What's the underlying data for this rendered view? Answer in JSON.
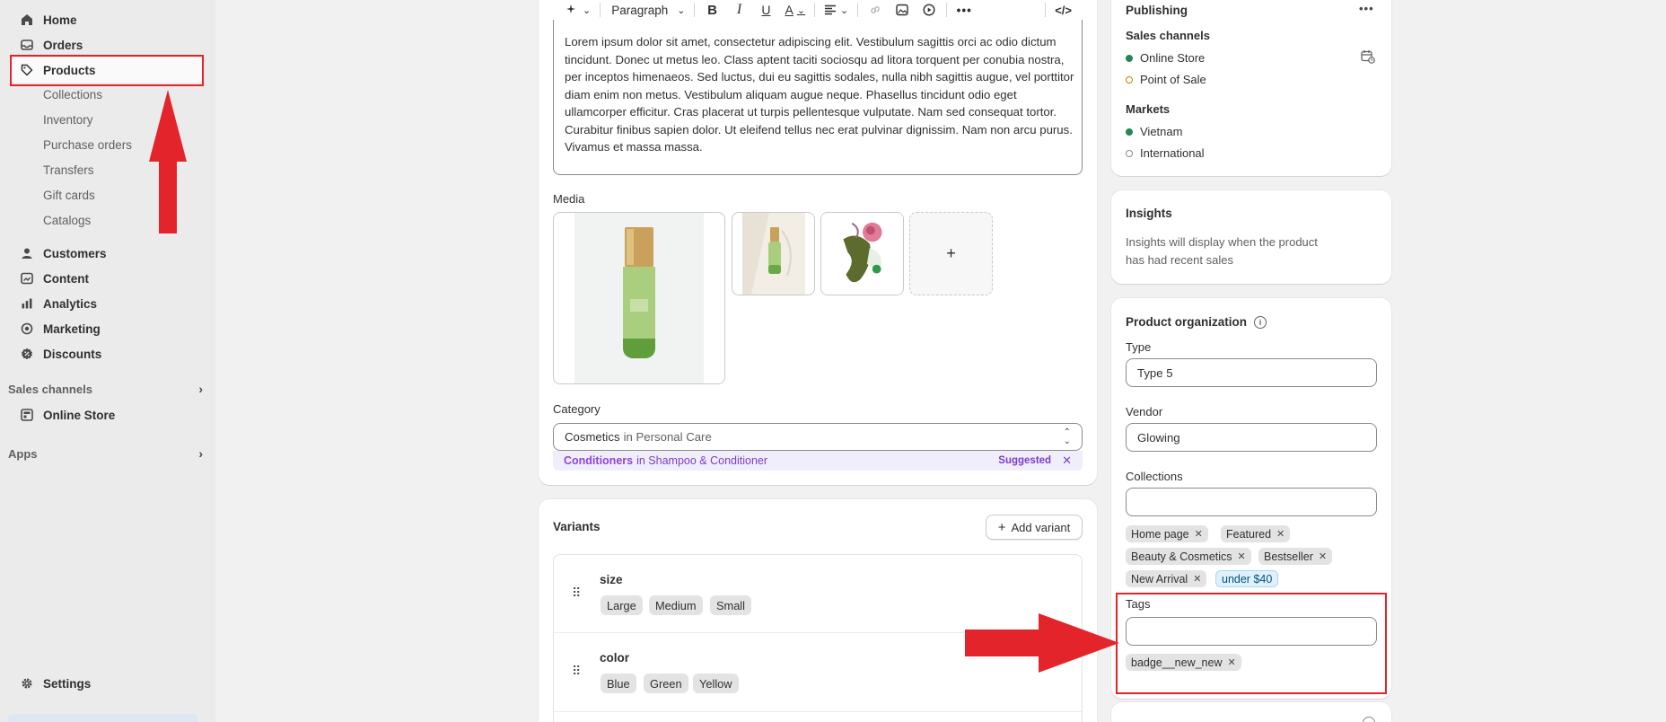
{
  "sidebar": {
    "items": [
      {
        "label": "Home",
        "icon": "home-icon"
      },
      {
        "label": "Orders",
        "icon": "inbox-icon"
      },
      {
        "label": "Products",
        "icon": "tag-icon"
      },
      {
        "label": "Customers",
        "icon": "person-icon"
      },
      {
        "label": "Content",
        "icon": "content-icon"
      },
      {
        "label": "Analytics",
        "icon": "analytics-icon"
      },
      {
        "label": "Marketing",
        "icon": "target-icon"
      },
      {
        "label": "Discounts",
        "icon": "discount-icon"
      }
    ],
    "product_subitems": [
      "Collections",
      "Inventory",
      "Purchase orders",
      "Transfers",
      "Gift cards",
      "Catalogs"
    ],
    "sales_channels_label": "Sales channels",
    "online_store_label": "Online Store",
    "apps_label": "Apps",
    "settings_label": "Settings"
  },
  "editor": {
    "paragraph_label": "Paragraph",
    "body": "Lorem ipsum dolor sit amet, consectetur adipiscing elit. Vestibulum sagittis orci ac odio dictum tincidunt. Donec ut metus leo. Class aptent taciti sociosqu ad litora torquent per conubia nostra, per inceptos himenaeos. Sed luctus, dui eu sagittis sodales, nulla nibh sagittis augue, vel porttitor diam enim non metus. Vestibulum aliquam augue neque. Phasellus tincidunt odio eget ullamcorper efficitur. Cras placerat ut turpis pellentesque vulputate. Nam sed consequat tortor. Curabitur finibus sapien dolor. Ut eleifend tellus nec erat pulvinar dignissim. Nam non arcu purus. Vivamus et massa massa."
  },
  "media": {
    "label": "Media",
    "add_symbol": "+"
  },
  "category": {
    "label": "Category",
    "value": "Cosmetics",
    "value_context": "in Personal Care",
    "suggestion": "Conditioners",
    "suggestion_context": "in Shampoo & Conditioner",
    "suggested_label": "Suggested"
  },
  "variants": {
    "title": "Variants",
    "add_button": "Add variant",
    "options": [
      {
        "name": "size",
        "values": [
          "Large",
          "Medium",
          "Small"
        ]
      },
      {
        "name": "color",
        "values": [
          "Blue",
          "Green",
          "Yellow"
        ]
      }
    ]
  },
  "publishing": {
    "title": "Publishing",
    "sales_channels_label": "Sales channels",
    "channels": [
      {
        "name": "Online Store",
        "status": "active"
      },
      {
        "name": "Point of Sale",
        "status": "inactive"
      }
    ],
    "markets_label": "Markets",
    "markets": [
      {
        "name": "Vietnam",
        "status": "active"
      },
      {
        "name": "International",
        "status": "inactive"
      }
    ]
  },
  "insights": {
    "title": "Insights",
    "text_line1": "Insights will display when the product",
    "text_line2": "has had recent sales"
  },
  "organization": {
    "title": "Product organization",
    "type_label": "Type",
    "type_value": "Type 5",
    "vendor_label": "Vendor",
    "vendor_value": "Glowing",
    "collections_label": "Collections",
    "collections": [
      "Home page",
      "Featured",
      "Beauty & Cosmetics",
      "Bestseller",
      "New Arrival"
    ],
    "accent_tag": "under $40",
    "tags_label": "Tags",
    "tags": [
      "badge__new_new"
    ]
  },
  "colors": {
    "annotation_red": "#e3252b",
    "active_green": "#29845a",
    "suggest_purple": "#8e43d9"
  }
}
